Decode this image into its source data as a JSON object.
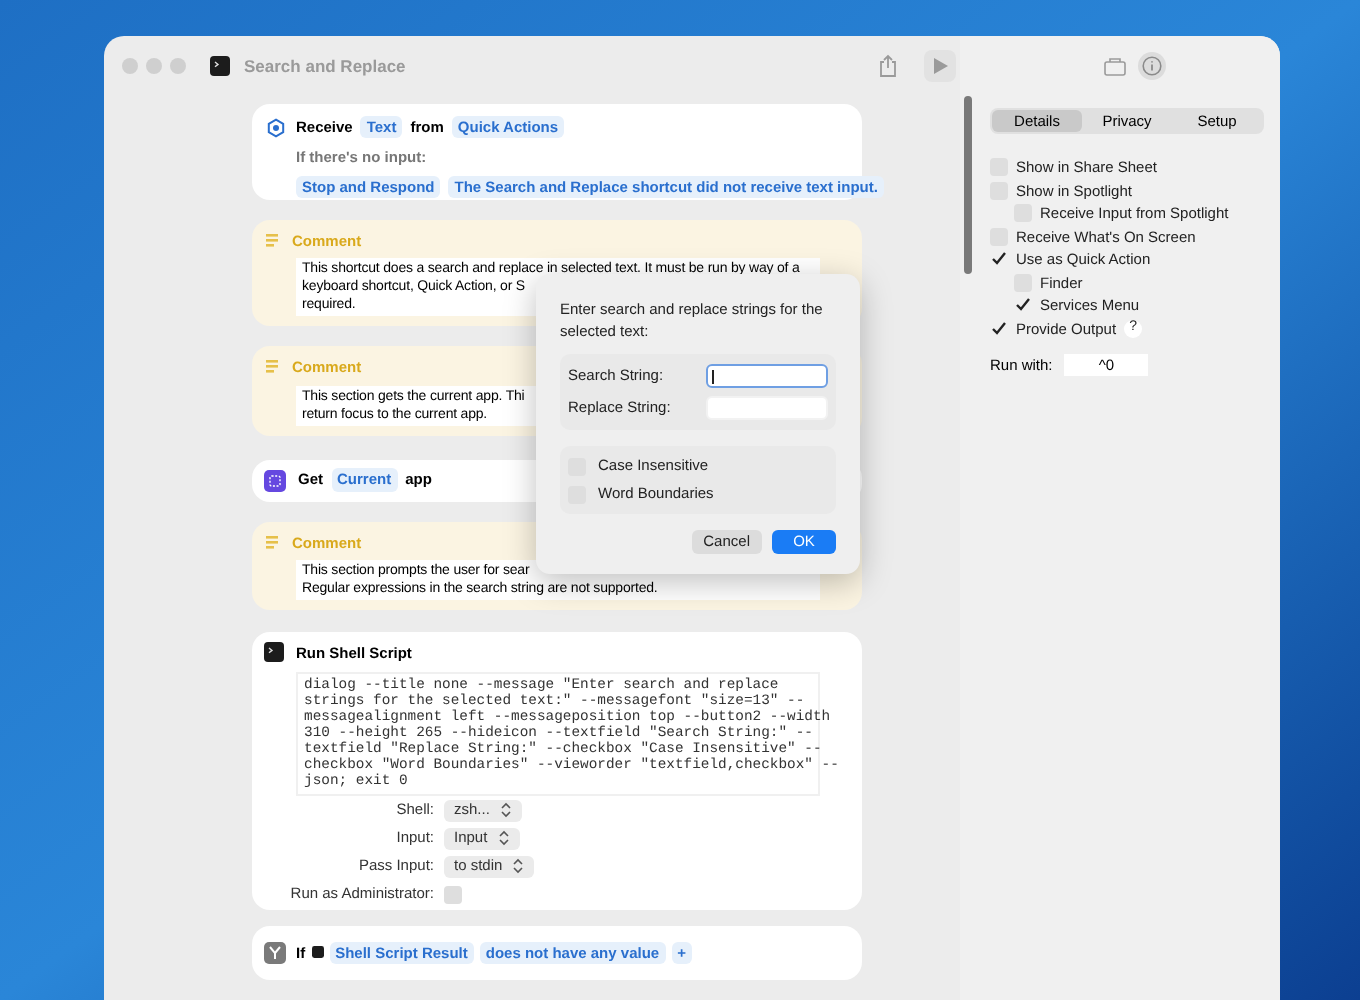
{
  "window": {
    "title": "Search and Replace"
  },
  "actions": [
    {
      "kind": "receive",
      "verb": "Receive",
      "tokens": [
        "Text",
        "Quick Actions"
      ],
      "joiner": "from",
      "subtitle": "If there's no input:",
      "options": [
        "Stop and Respond",
        "The Search and Replace shortcut did not receive text input."
      ]
    },
    {
      "kind": "comment",
      "title": "Comment",
      "lines": [
        "This shortcut does a search and replace in selected text. It must be run by way of a",
        "keyboard shortcut, Quick Action, or S",
        "required."
      ]
    },
    {
      "kind": "comment",
      "title": "Comment",
      "lines": [
        "This section gets the current app. Thi",
        "return focus to the current app."
      ]
    },
    {
      "kind": "get",
      "verb": "Get",
      "token": "Current",
      "suffix": "app"
    },
    {
      "kind": "comment",
      "title": "Comment",
      "lines": [
        "This section prompts the user for sear",
        "Regular expressions in the search string are not supported."
      ]
    },
    {
      "kind": "shell",
      "title": "Run Shell Script",
      "code": [
        "dialog --title none --message \"Enter search and replace",
        "strings for the selected text:\" --messagefont \"size=13\" --",
        "messagealignment left --messageposition top --button2 --width",
        "310 --height 265 --hideicon --textfield \"Search String:\" --",
        "textfield \"Replace String:\" --checkbox \"Case Insensitive\" --",
        "checkbox \"Word Boundaries\" --vieworder \"textfield,checkbox\" --",
        "json; exit 0"
      ],
      "params": [
        {
          "label": "Shell:",
          "value": "zsh..."
        },
        {
          "label": "Input:",
          "value": "Input"
        },
        {
          "label": "Pass Input:",
          "value": "to stdin"
        }
      ],
      "admin": {
        "label": "Run as Administrator:",
        "checked": false
      }
    },
    {
      "kind": "if",
      "verb": "If",
      "tokens": [
        "Shell Script Result",
        "does not have any value",
        "+"
      ]
    }
  ],
  "dialog": {
    "message": "Enter search and replace strings for the selected text:",
    "fields": [
      {
        "label": "Search String:",
        "focused": true
      },
      {
        "label": "Replace String:",
        "focused": false
      }
    ],
    "checkboxes": [
      {
        "label": "Case Insensitive",
        "checked": false
      },
      {
        "label": "Word Boundaries",
        "checked": false
      }
    ],
    "buttons": [
      {
        "label": "Cancel",
        "default": false
      },
      {
        "label": "OK",
        "default": true
      }
    ]
  },
  "sidebar": {
    "tabs": [
      {
        "label": "Details",
        "selected": true
      },
      {
        "label": "Privacy",
        "selected": false
      },
      {
        "label": "Setup",
        "selected": false
      }
    ],
    "options": [
      {
        "label": "Show in Share Sheet",
        "checked": false
      },
      {
        "label": "Show in Spotlight",
        "checked": false,
        "children": [
          {
            "label": "Receive Input from Spotlight",
            "checked": false
          }
        ]
      },
      {
        "label": "Receive What's On Screen",
        "checked": false
      },
      {
        "label": "Use as Quick Action",
        "checked": true,
        "children": [
          {
            "label": "Finder",
            "checked": false
          },
          {
            "label": "Services Menu",
            "checked": true
          }
        ]
      },
      {
        "label": "Provide Output",
        "checked": true,
        "help": "?"
      }
    ],
    "run_with": {
      "label": "Run with:",
      "value": "^0"
    }
  }
}
